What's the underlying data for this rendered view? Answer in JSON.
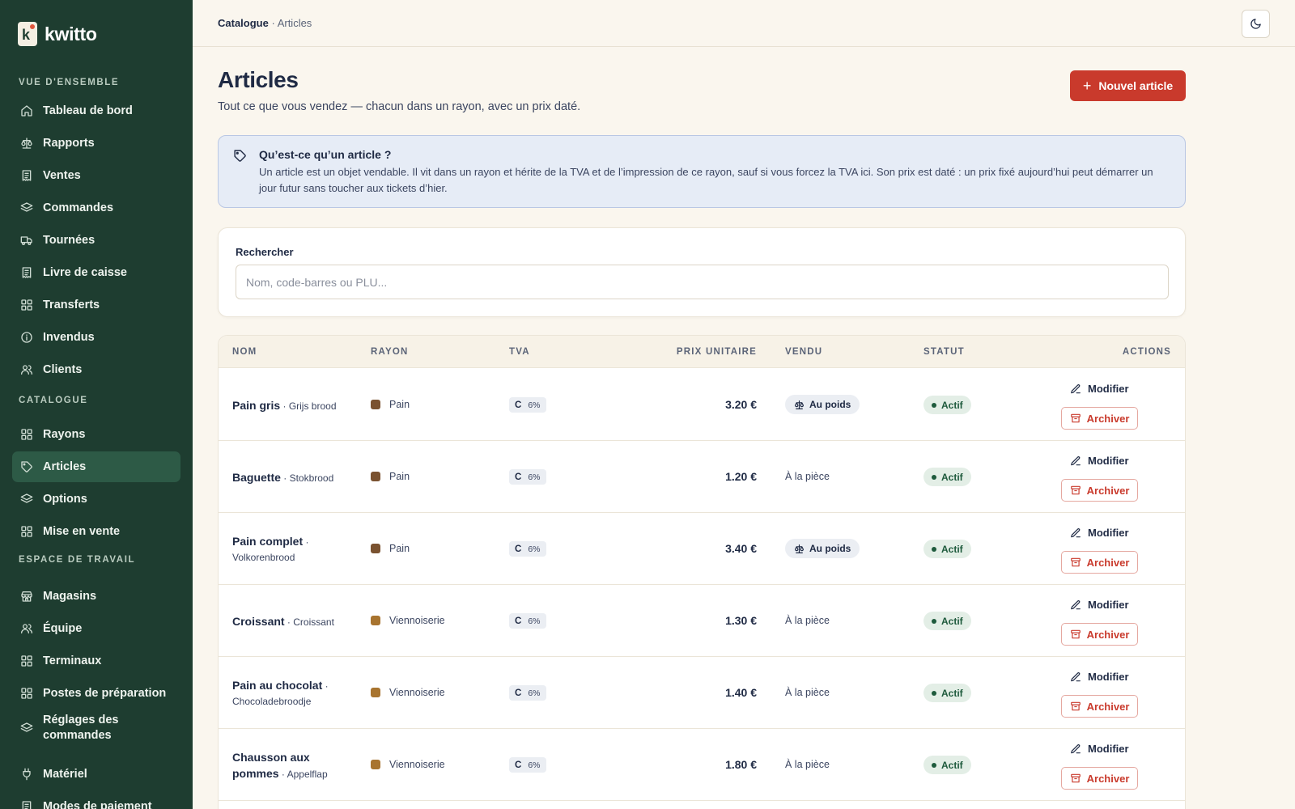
{
  "app": {
    "name": "kwitto",
    "logo_letter": "k"
  },
  "sidebar": {
    "sections": [
      {
        "label": "VUE D'ENSEMBLE"
      },
      {
        "label": "CATALOGUE"
      },
      {
        "label": "ESPACE DE TRAVAIL"
      }
    ],
    "items": [
      {
        "label": "Tableau de bord",
        "icon": "home-icon"
      },
      {
        "label": "Rapports",
        "icon": "scale-icon"
      },
      {
        "label": "Ventes",
        "icon": "receipt-icon"
      },
      {
        "label": "Commandes",
        "icon": "layers-icon"
      },
      {
        "label": "Tournées",
        "icon": "truck-icon"
      },
      {
        "label": "Livre de caisse",
        "icon": "receipt-icon"
      },
      {
        "label": "Transferts",
        "icon": "grid-icon"
      },
      {
        "label": "Invendus",
        "icon": "info-icon"
      },
      {
        "label": "Clients",
        "icon": "users-icon"
      },
      {
        "label": "Rayons",
        "icon": "grid-icon"
      },
      {
        "label": "Articles",
        "icon": "tag-icon",
        "active": true
      },
      {
        "label": "Options",
        "icon": "layers-icon"
      },
      {
        "label": "Mise en vente",
        "icon": "grid-icon"
      },
      {
        "label": "Magasins",
        "icon": "store-icon"
      },
      {
        "label": "Équipe",
        "icon": "users-icon"
      },
      {
        "label": "Terminaux",
        "icon": "grid-icon"
      },
      {
        "label": "Postes de préparation",
        "icon": "grid-icon"
      },
      {
        "label": "Réglages des commandes",
        "icon": "layers-icon"
      },
      {
        "label": "Matériel",
        "icon": "plug-icon"
      },
      {
        "label": "Modes de paiement",
        "icon": "receipt-icon"
      }
    ]
  },
  "header": {
    "breadcrumb": {
      "parent": "Catalogue",
      "separator": " · ",
      "current": "Articles"
    },
    "theme_toggle_icon": "moon-icon"
  },
  "page": {
    "title": "Articles",
    "subtitle": "Tout ce que vous vendez — chacun dans un rayon, avec un prix daté.",
    "new_button": "Nouvel article",
    "info": {
      "title": "Qu’est-ce qu’un article ?",
      "text": "Un article est un objet vendable. Il vit dans un rayon et hérite de la TVA et de l’impression de ce rayon, sauf si vous forcez la TVA ici. Son prix est daté : un prix fixé aujourd’hui peut démarrer un jour futur sans toucher aux tickets d’hier."
    },
    "search": {
      "label": "Rechercher",
      "placeholder": "Nom, code-barres ou PLU...",
      "value": ""
    }
  },
  "table": {
    "columns": [
      "NOM",
      "RAYON",
      "TVA",
      "PRIX UNITAIRE",
      "VENDU",
      "STATUT",
      "ACTIONS"
    ],
    "edit_label": "Modifier",
    "archive_label": "Archiver",
    "rows": [
      {
        "name": "Pain gris",
        "alt": "Grijs brood",
        "rayon": "Pain",
        "rayon_color": "#7a5230",
        "tva_code": "C",
        "tva_rate": "6%",
        "price": "3.20 €",
        "sold": "Au poids",
        "by_weight": true,
        "status": "Actif"
      },
      {
        "name": "Baguette",
        "alt": "Stokbrood",
        "rayon": "Pain",
        "rayon_color": "#7a5230",
        "tva_code": "C",
        "tva_rate": "6%",
        "price": "1.20 €",
        "sold": "À la pièce",
        "by_weight": false,
        "status": "Actif"
      },
      {
        "name": "Pain complet",
        "alt": "Volkorenbrood",
        "rayon": "Pain",
        "rayon_color": "#7a5230",
        "tva_code": "C",
        "tva_rate": "6%",
        "price": "3.40 €",
        "sold": "Au poids",
        "by_weight": true,
        "status": "Actif"
      },
      {
        "name": "Croissant",
        "alt": "Croissant",
        "rayon": "Viennoiserie",
        "rayon_color": "#a8742f",
        "tva_code": "C",
        "tva_rate": "6%",
        "price": "1.30 €",
        "sold": "À la pièce",
        "by_weight": false,
        "status": "Actif"
      },
      {
        "name": "Pain au chocolat",
        "alt": "Chocoladebroodje",
        "rayon": "Viennoiserie",
        "rayon_color": "#a8742f",
        "tva_code": "C",
        "tva_rate": "6%",
        "price": "1.40 €",
        "sold": "À la pièce",
        "by_weight": false,
        "status": "Actif"
      },
      {
        "name": "Chausson aux pommes",
        "alt": "Appelflap",
        "rayon": "Viennoiserie",
        "rayon_color": "#a8742f",
        "tva_code": "C",
        "tva_rate": "6%",
        "price": "1.80 €",
        "sold": "À la pièce",
        "by_weight": false,
        "status": "Actif"
      }
    ]
  },
  "colors": {
    "sidebar_bg": "#1e3d30",
    "accent": "#c93a2c",
    "page_bg": "#faf6ee",
    "info_bg": "#e6ecf6"
  }
}
